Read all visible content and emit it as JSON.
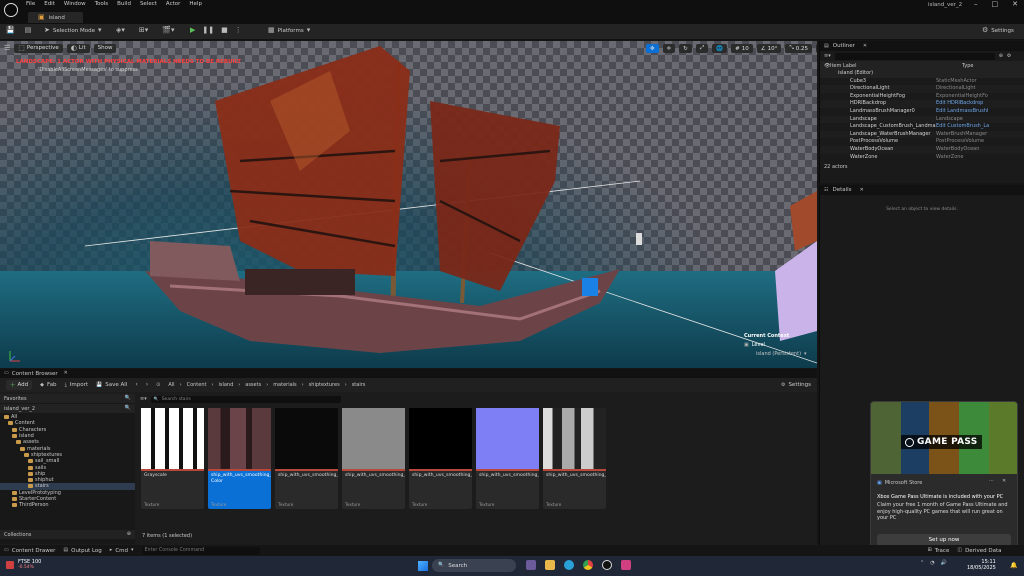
{
  "menu": [
    "File",
    "Edit",
    "Window",
    "Tools",
    "Build",
    "Select",
    "Actor",
    "Help"
  ],
  "project_tab": "island",
  "window_title": "island_ver_2",
  "toolbar": {
    "selection_mode": "Selection Mode",
    "platforms": "Platforms",
    "settings": "Settings"
  },
  "viewport": {
    "perspective": "Perspective",
    "lit": "Lit",
    "show": "Show",
    "warning": "LANDSCAPE: 1 ACTOR WITH PHYSICAL MATERIALS NEEDS TO BE REBUILT",
    "sub_warning": "'DisableAllScreenMessages' to suppress",
    "grid_value": "10",
    "angle_value": "10°",
    "scale_value": "0.25",
    "camera_speed": "1",
    "context_label": "Current Context",
    "level_label": "Level",
    "level_value": "island (Persistent)"
  },
  "outliner": {
    "tab": "Outliner",
    "col_label": "Item Label",
    "col_type": "Type",
    "root": "island (Editor)",
    "rows": [
      {
        "name": "Cube3",
        "type": "StaticMeshActor",
        "link": false
      },
      {
        "name": "DirectionalLight",
        "type": "DirectionalLight",
        "link": false
      },
      {
        "name": "ExponentialHeightFog",
        "type": "ExponentialHeightFo",
        "link": false
      },
      {
        "name": "HDRIBackdrop",
        "type": "Edit HDRIBackdrop",
        "link": true
      },
      {
        "name": "LandmassBrushManager0",
        "type": "Edit LandmassBrushI",
        "link": true
      },
      {
        "name": "Landscape",
        "type": "Landscape",
        "link": false
      },
      {
        "name": "Landscape_CustomBrush_Landmass_C",
        "type": "Edit CustomBrush_La",
        "link": true
      },
      {
        "name": "Landscape_WaterBrushManager",
        "type": "WaterBrushManager",
        "link": false
      },
      {
        "name": "PostProcessVolume",
        "type": "PostProcessVolume",
        "link": false
      },
      {
        "name": "WaterBodyOcean",
        "type": "WaterBodyOcean",
        "link": false
      },
      {
        "name": "WaterZone",
        "type": "WaterZone",
        "link": false
      }
    ],
    "count": "22 actors"
  },
  "details": {
    "tab": "Details",
    "empty": "Select an object to view details."
  },
  "content_browser": {
    "tab": "Content Browser",
    "add": "Add",
    "import": "Import",
    "save_all": "Save All",
    "fab": "Fab",
    "settings": "Settings",
    "breadcrumb": [
      "All",
      "Content",
      "island",
      "assets",
      "materials",
      "shiptextures",
      "stairs"
    ],
    "search_placeholder": "Search stairs",
    "favorites": "Favorites",
    "project": "island_ver_2",
    "collections": "Collections",
    "tree": [
      {
        "label": "All",
        "indent": 0
      },
      {
        "label": "Content",
        "indent": 1
      },
      {
        "label": "Characters",
        "indent": 2
      },
      {
        "label": "island",
        "indent": 2
      },
      {
        "label": "assets",
        "indent": 3
      },
      {
        "label": "materials",
        "indent": 4
      },
      {
        "label": "shiptextures",
        "indent": 5
      },
      {
        "label": "sail_small",
        "indent": 6
      },
      {
        "label": "sails",
        "indent": 6
      },
      {
        "label": "ship",
        "indent": 6
      },
      {
        "label": "shiphut",
        "indent": 6
      },
      {
        "label": "stairs",
        "indent": 6
      },
      {
        "label": "LevelPrototyping",
        "indent": 2
      },
      {
        "label": "StarterContent",
        "indent": 2
      },
      {
        "label": "ThirdPerson",
        "indent": 2
      }
    ],
    "assets": [
      {
        "name": "Grayscale",
        "type": "Texture"
      },
      {
        "name": "ship_with_uvs_smoothing_groups_boat_stairs_Base Color",
        "type": "Texture"
      },
      {
        "name": "ship_with_uvs_smoothing_groups_boat_stairs_Emissive",
        "type": "Texture"
      },
      {
        "name": "ship_with_uvs_smoothing_groups_boat_stairs_Height",
        "type": "Texture"
      },
      {
        "name": "ship_with_uvs_smoothing_groups_boat_stairs_Metallic",
        "type": "Texture"
      },
      {
        "name": "ship_with_uvs_smoothing_groups_boat_stairs_Normal",
        "type": "Texture"
      },
      {
        "name": "ship_with_uvs_smoothing_groups_boat_stairs_Roughness",
        "type": "Texture"
      }
    ],
    "selection_info": "7 items (1 selected)"
  },
  "statusbar": {
    "content_drawer": "Content Drawer",
    "output_log": "Output Log",
    "cmd": "Cmd",
    "console_placeholder": "Enter Console Command",
    "trace": "Trace",
    "derived_data": "Derived Data"
  },
  "taskbar": {
    "stock_name": "FTSE 100",
    "stock_change": "-0.54%",
    "search": "Search",
    "time": "15:11",
    "date": "18/05/2025"
  },
  "toast": {
    "app": "Microsoft Store",
    "badge": "GAME PASS",
    "title": "Xbox Game Pass Ultimate is included with your PC",
    "body": "Claim your free 1 month of Game Pass Ultimate and enjoy high-quality PC games that will run great on your PC",
    "button": "Set up now"
  },
  "colors": {
    "accent": "#0b70d6",
    "warning": "#ff4040",
    "link": "#6ea6e8"
  }
}
